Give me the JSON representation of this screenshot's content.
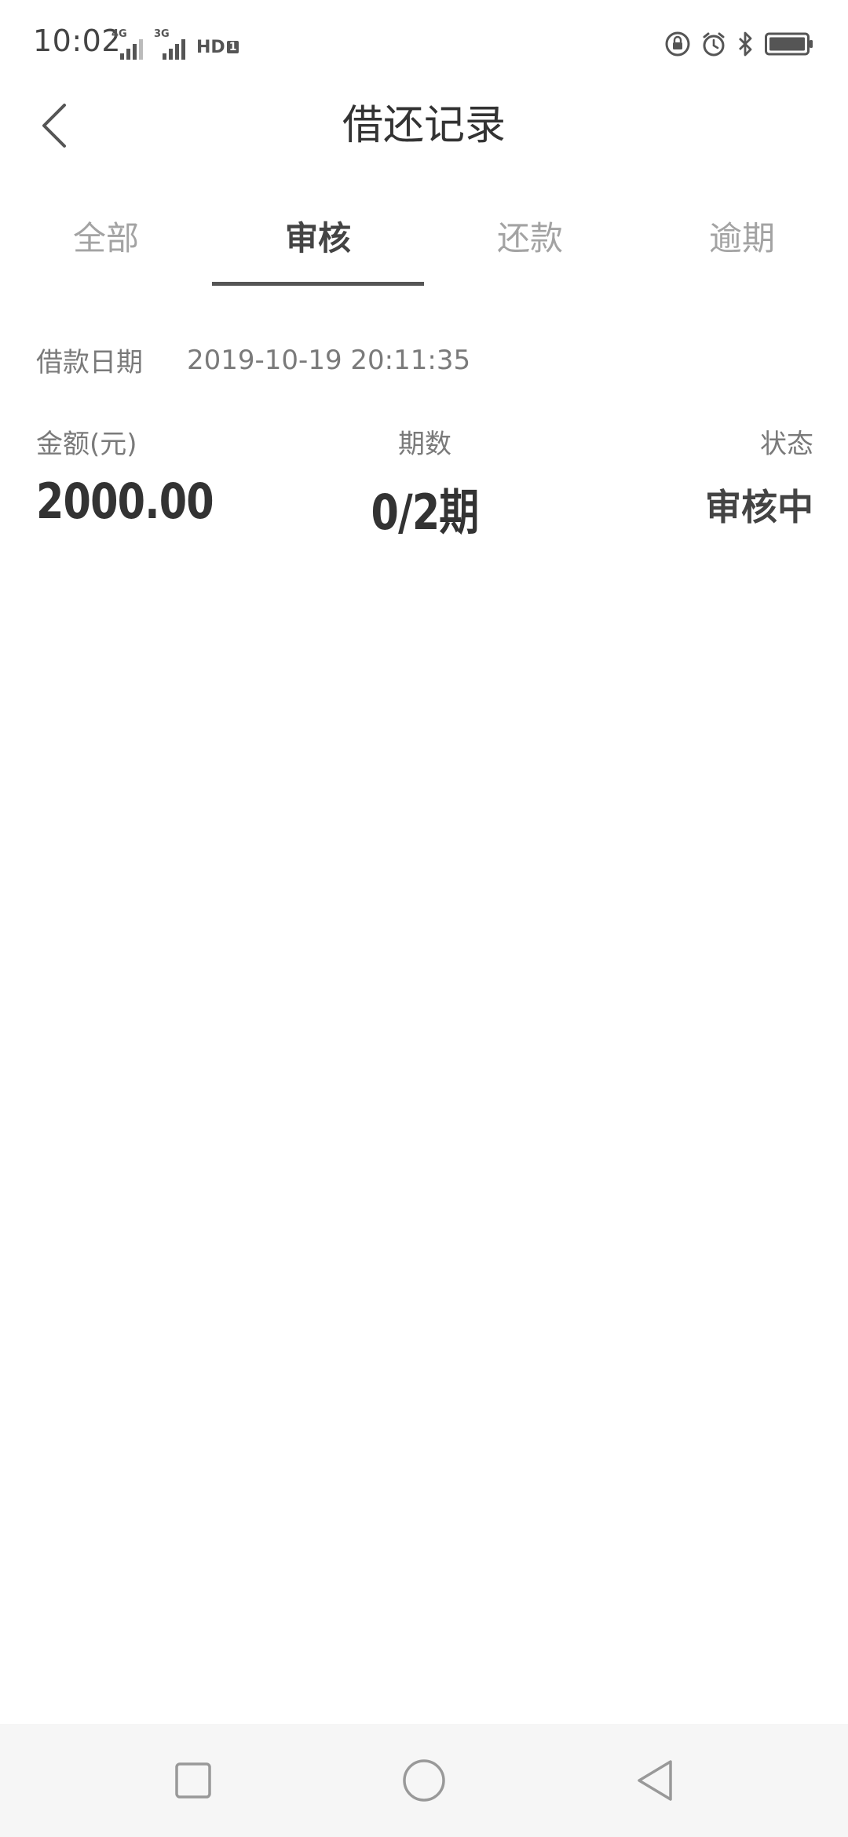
{
  "status_bar": {
    "time": "10:02",
    "network_1": "4G",
    "network_2": "3G",
    "hd_label": "HD",
    "hd_sub": "1",
    "icons": [
      "screen-lock-icon",
      "alarm-icon",
      "bluetooth-icon",
      "battery-icon"
    ]
  },
  "header": {
    "title": "借还记录",
    "back_icon": "chevron-left-icon"
  },
  "tabs": [
    {
      "label": "全部",
      "active": false
    },
    {
      "label": "审核",
      "active": true
    },
    {
      "label": "还款",
      "active": false
    },
    {
      "label": "逾期",
      "active": false
    }
  ],
  "record": {
    "date_label": "借款日期",
    "date_value": "2019-10-19 20:11:35",
    "amount_label": "金额(元)",
    "amount_value": "2000.00",
    "periods_label": "期数",
    "periods_value": "0/2期",
    "status_label": "状态",
    "status_value": "审核中"
  },
  "nav_bar": {
    "icons": [
      "recents-square-icon",
      "home-circle-icon",
      "back-triangle-icon"
    ]
  },
  "colors": {
    "text_primary": "#333333",
    "text_secondary": "#7a7a7a",
    "tab_inactive": "#a3a3a3",
    "tab_indicator": "#555555",
    "nav_background": "#f6f6f6"
  }
}
